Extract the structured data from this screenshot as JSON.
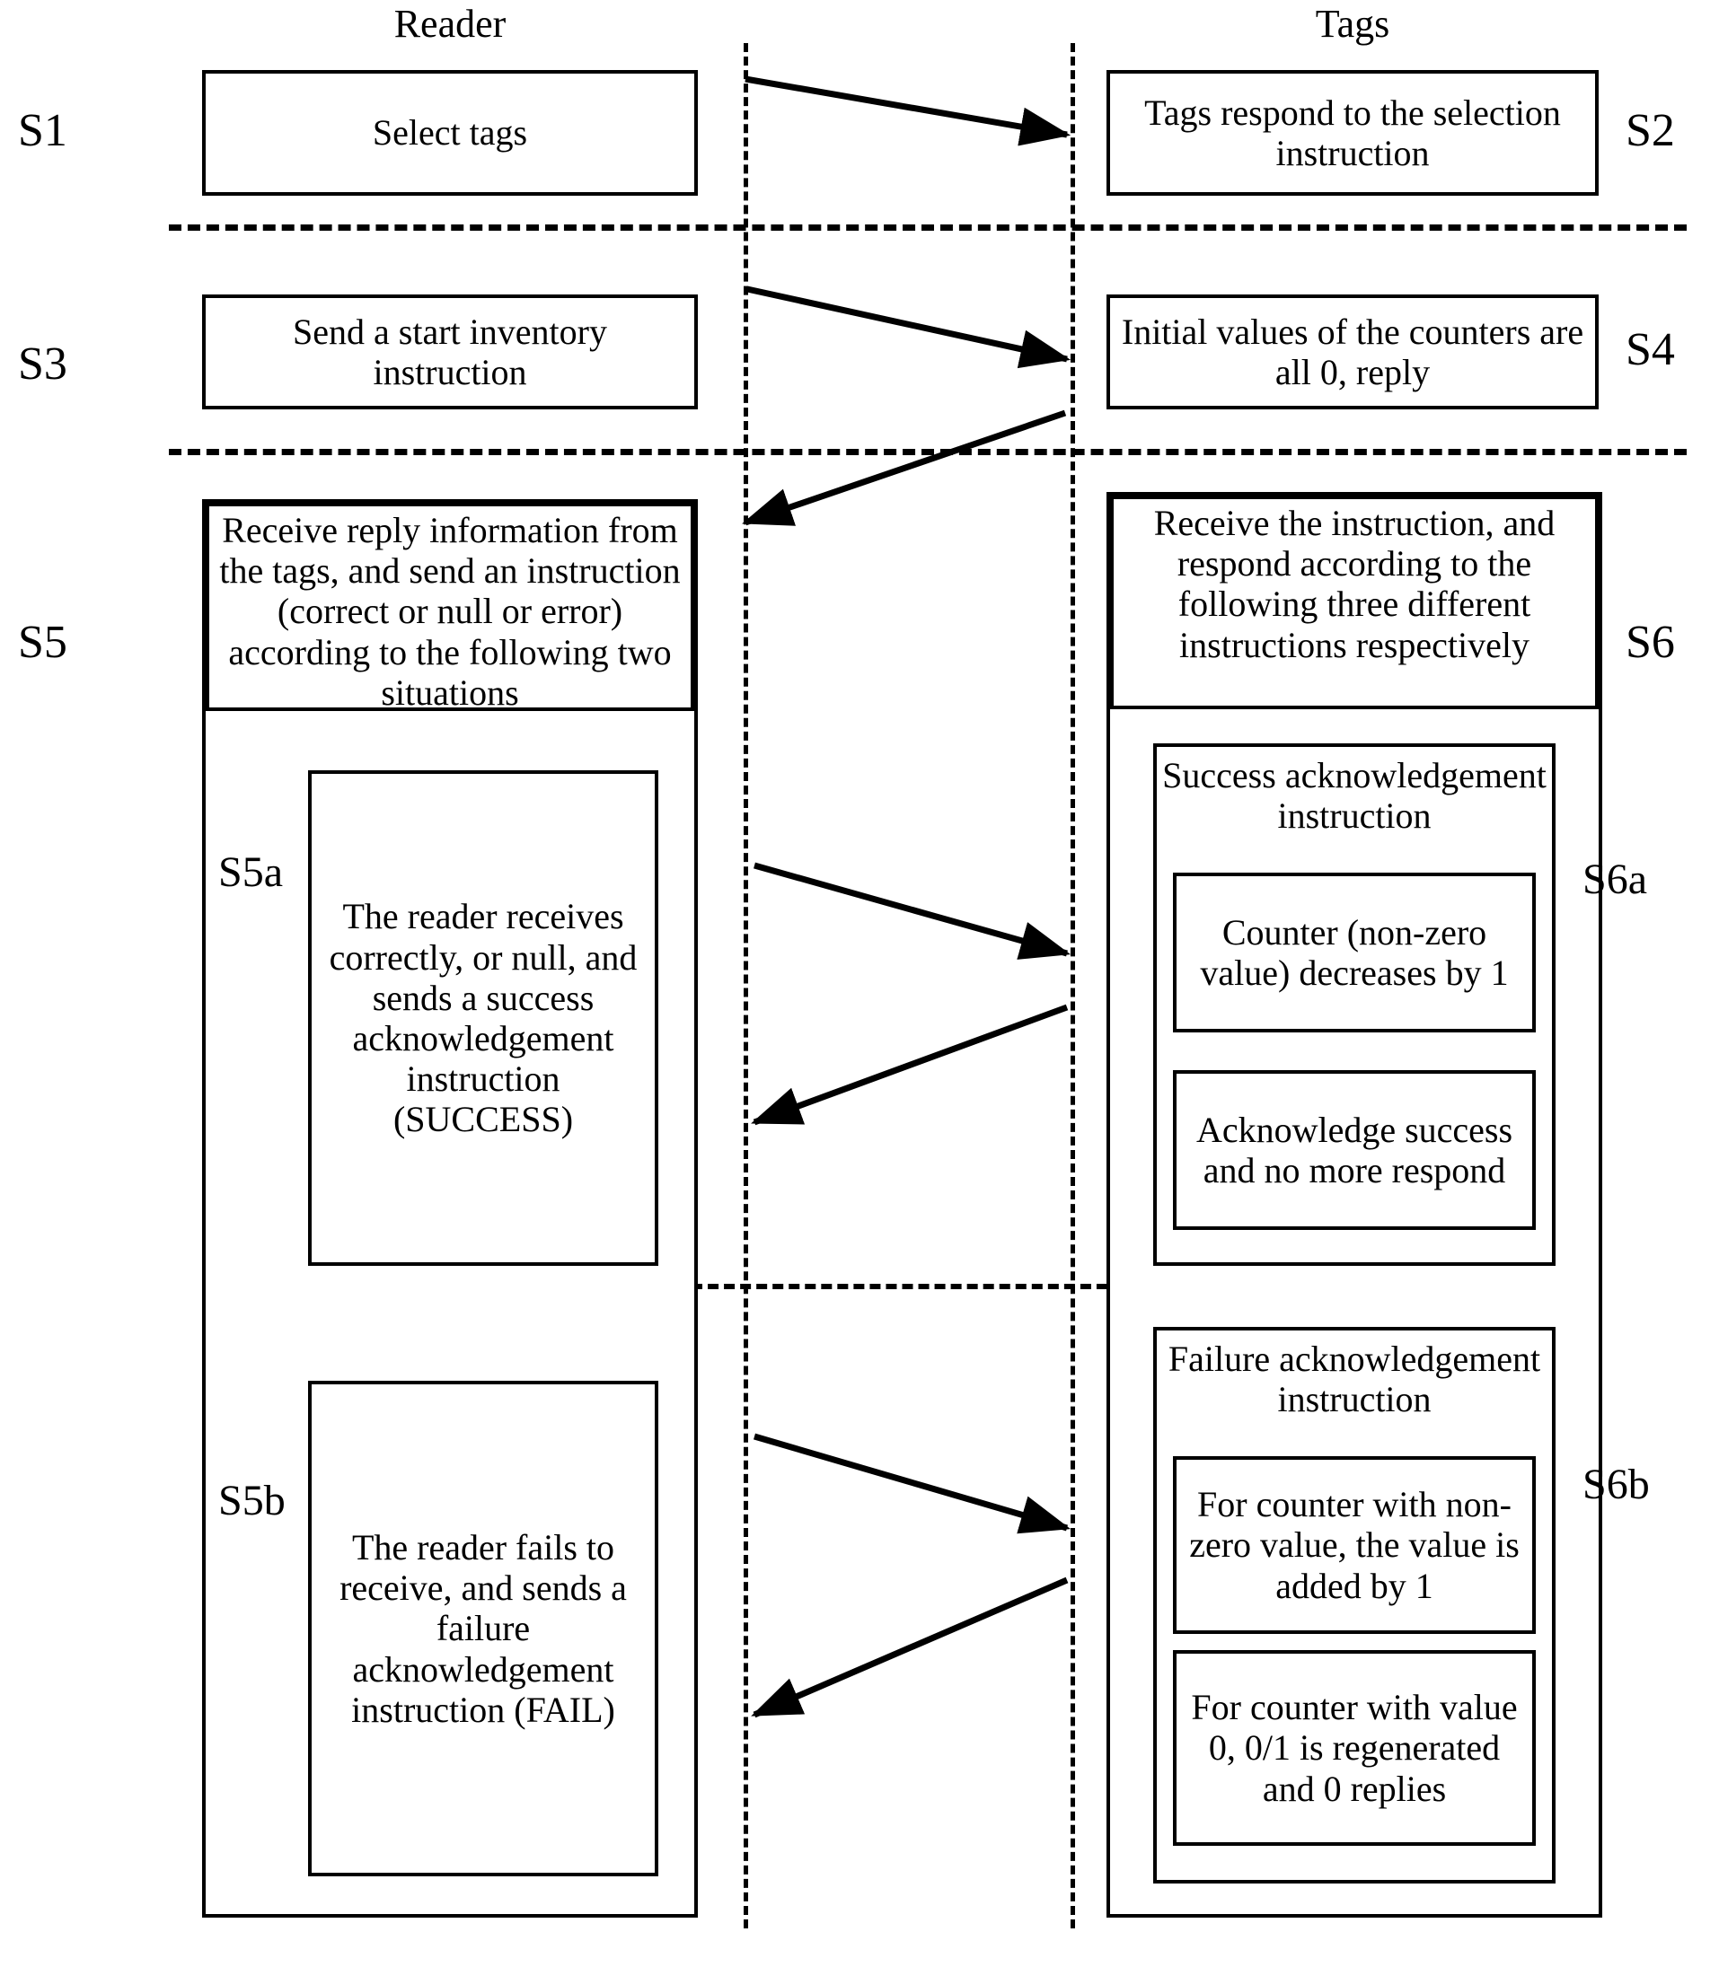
{
  "diagram": {
    "columns": {
      "left_header": "Reader",
      "right_header": "Tags"
    },
    "steps": {
      "s1": {
        "label": "S1",
        "text": "Select tags"
      },
      "s2": {
        "label": "S2",
        "text": "Tags respond to the selection instruction"
      },
      "s3": {
        "label": "S3",
        "text": "Send a start inventory instruction"
      },
      "s4": {
        "label": "S4",
        "text": "Initial values of the counters are all 0, reply"
      },
      "s5": {
        "label": "S5",
        "text": "Receive reply information from the tags, and send an instruction (correct or null or error) according to the following two situations"
      },
      "s6": {
        "label": "S6",
        "text": "Receive the instruction, and respond according to the following three different instructions respectively"
      },
      "s5a": {
        "label": "S5a",
        "text": "The reader receives correctly, or null, and sends a success acknowledgement instruction (SUCCESS)"
      },
      "s6a": {
        "label": "S6a",
        "title": "Success acknowledgement instruction",
        "sub1": "Counter (non-zero value) decreases by 1",
        "sub2": "Acknowledge success and no more respond"
      },
      "s5b": {
        "label": "S5b",
        "text": "The reader fails to receive, and sends a failure acknowledgement instruction (FAIL)"
      },
      "s6b": {
        "label": "S6b",
        "title": "Failure acknowledgement instruction",
        "sub1": "For counter with non-zero value, the value is added by 1",
        "sub2": "For counter with value 0, 0/1 is regenerated and 0 replies"
      }
    },
    "arrows": [
      {
        "name": "arrow-s1-to-s2",
        "direction": "right"
      },
      {
        "name": "arrow-s3-to-s4",
        "direction": "right"
      },
      {
        "name": "arrow-s4-to-s5",
        "direction": "left"
      },
      {
        "name": "arrow-s5a-to-s6a",
        "direction": "right"
      },
      {
        "name": "arrow-s6a-to-s5a",
        "direction": "left"
      },
      {
        "name": "arrow-s5b-to-s6b",
        "direction": "right"
      },
      {
        "name": "arrow-s6b-to-s5b",
        "direction": "left"
      }
    ],
    "colors": {
      "stroke": "#000000",
      "background": "#ffffff"
    }
  }
}
